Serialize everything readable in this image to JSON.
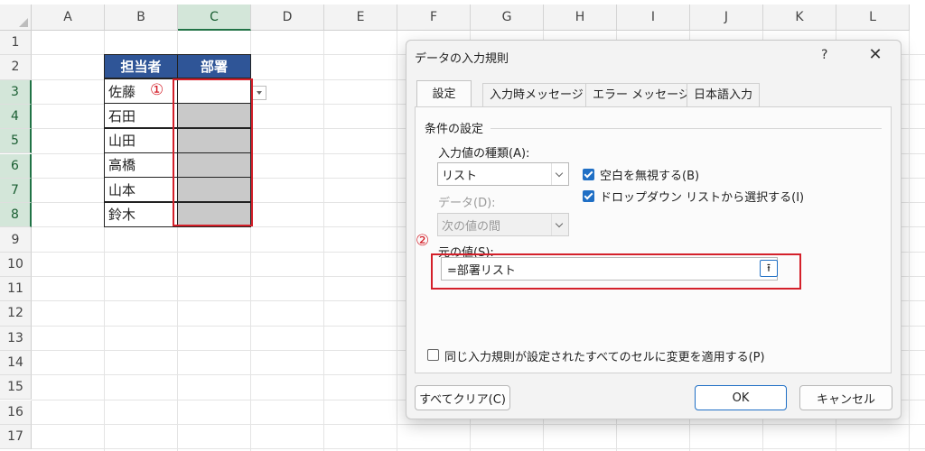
{
  "sheet": {
    "columns": [
      "A",
      "B",
      "C",
      "D",
      "E",
      "F",
      "G",
      "H",
      "I",
      "J",
      "K",
      "L"
    ],
    "rows": [
      "1",
      "2",
      "3",
      "4",
      "5",
      "6",
      "7",
      "8",
      "9",
      "10",
      "11",
      "12",
      "13",
      "14",
      "15",
      "16",
      "17"
    ],
    "table_headers": {
      "person": "担当者",
      "dept": "部署"
    },
    "names": [
      "佐藤",
      "石田",
      "山田",
      "高橋",
      "山本",
      "鈴木"
    ],
    "marker1": "①"
  },
  "dialog": {
    "title": "データの入力規則",
    "help": "?",
    "close": "✕",
    "tabs": [
      "設定",
      "入力時メッセージ",
      "エラー メッセージ",
      "日本語入力"
    ],
    "section": "条件の設定",
    "allow_label": "入力値の種類(A):",
    "allow_value": "リスト",
    "data_label": "データ(D):",
    "data_value": "次の値の間",
    "ignore_blank": "空白を無視する(B)",
    "in_cell_dropdown": "ドロップダウン リストから選択する(I)",
    "source_label": "元の値(S):",
    "source_value": "=部署リスト",
    "marker2": "②",
    "apply_all": "同じ入力規則が設定されたすべてのセルに変更を適用する(P)",
    "clear_all": "すべてクリア(C)",
    "ok": "OK",
    "cancel": "キャンセル"
  },
  "colors": {
    "header_fill": "#2f5597",
    "highlight": "#d4202a",
    "accent": "#1f6fc5",
    "selected_fill": "#c9c9c9"
  }
}
